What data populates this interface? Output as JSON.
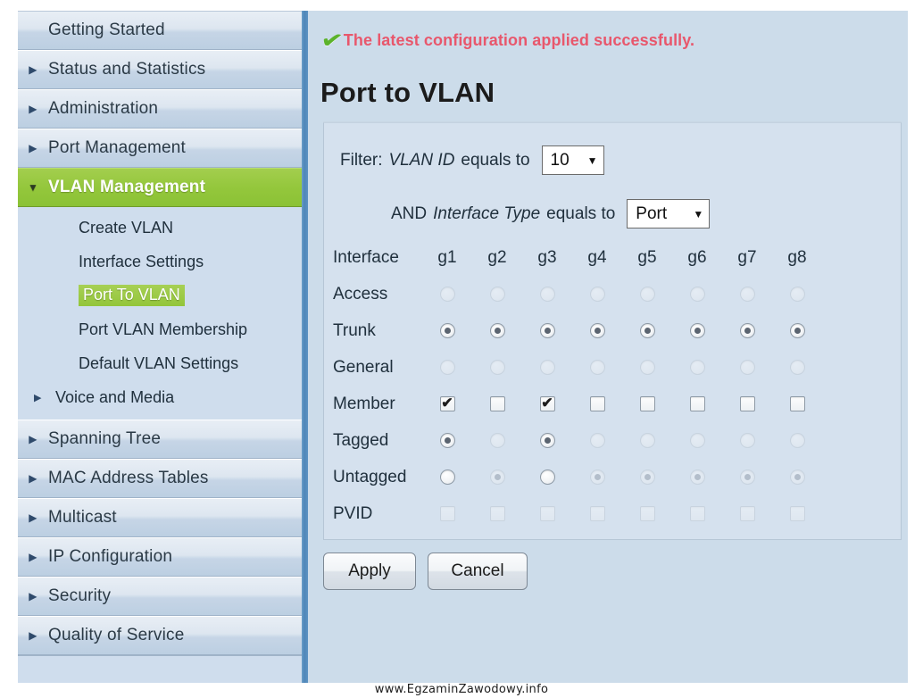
{
  "accent": {
    "green": "#93c53a",
    "status_red": "#e8576c",
    "check_green": "#5cb32b",
    "sidebar_bg": "#cfdded",
    "content_bg": "#ccdcea",
    "panel_bg": "#d5e1ee",
    "divider_blue": "#4f86b8"
  },
  "sidebar": {
    "items": [
      {
        "label": "Getting Started",
        "arrow": "",
        "expanded": false,
        "active": false
      },
      {
        "label": "Status and Statistics",
        "arrow": "▶",
        "expanded": false,
        "active": false
      },
      {
        "label": "Administration",
        "arrow": "▶",
        "expanded": false,
        "active": false
      },
      {
        "label": "Port Management",
        "arrow": "▶",
        "expanded": false,
        "active": false
      },
      {
        "label": "VLAN Management",
        "arrow": "▼",
        "expanded": true,
        "active": true
      }
    ],
    "sub_items": [
      {
        "label": "Create VLAN",
        "arrow": "",
        "selected": false
      },
      {
        "label": "Interface Settings",
        "arrow": "",
        "selected": false
      },
      {
        "label": "Port To VLAN",
        "arrow": "",
        "selected": true
      },
      {
        "label": "Port VLAN Membership",
        "arrow": "",
        "selected": false
      },
      {
        "label": "Default VLAN Settings",
        "arrow": "",
        "selected": false
      },
      {
        "label": "Voice and Media",
        "arrow": "▶",
        "selected": false
      }
    ],
    "items_tail": [
      {
        "label": "Spanning Tree",
        "arrow": "▶"
      },
      {
        "label": "MAC Address Tables",
        "arrow": "▶"
      },
      {
        "label": "Multicast",
        "arrow": "▶"
      },
      {
        "label": "IP Configuration",
        "arrow": "▶"
      },
      {
        "label": "Security",
        "arrow": "▶"
      },
      {
        "label": "Quality of Service",
        "arrow": "▶"
      }
    ]
  },
  "status": {
    "icon": "check-icon",
    "message": "The latest configuration applied successfully."
  },
  "page": {
    "title": "Port to VLAN"
  },
  "filter": {
    "label": "Filter:",
    "field1": "VLAN ID",
    "equals1": "equals to",
    "vlan_id_value": "10",
    "and": "AND",
    "field2": "Interface Type",
    "equals2": "equals to",
    "interface_type_value": "Port",
    "caret": "▼"
  },
  "table": {
    "row_label_header": "Interface",
    "columns": [
      "g1",
      "g2",
      "g3",
      "g4",
      "g5",
      "g6",
      "g7",
      "g8"
    ],
    "rows": [
      {
        "label": "Access",
        "control": "radio",
        "states": [
          "off-dim",
          "off-dim",
          "off-dim",
          "off-dim",
          "off-dim",
          "off-dim",
          "off-dim",
          "off-dim"
        ]
      },
      {
        "label": "Trunk",
        "control": "radio",
        "states": [
          "on",
          "on",
          "on",
          "on",
          "on",
          "on",
          "on",
          "on"
        ]
      },
      {
        "label": "General",
        "control": "radio",
        "states": [
          "off-dim",
          "off-dim",
          "off-dim",
          "off-dim",
          "off-dim",
          "off-dim",
          "off-dim",
          "off-dim"
        ]
      },
      {
        "label": "Member",
        "control": "checkbox",
        "states": [
          "on",
          "off",
          "on",
          "off",
          "off",
          "off",
          "off",
          "off"
        ]
      },
      {
        "label": "Tagged",
        "control": "radio",
        "states": [
          "on",
          "off-dim",
          "on",
          "off-dim",
          "off-dim",
          "off-dim",
          "off-dim",
          "off-dim"
        ]
      },
      {
        "label": "Untagged",
        "control": "radio",
        "states": [
          "off",
          "on-dim",
          "off",
          "on-dim",
          "on-dim",
          "on-dim",
          "on-dim",
          "on-dim"
        ]
      },
      {
        "label": "PVID",
        "control": "checkbox",
        "states": [
          "off-dim",
          "off-dim",
          "off-dim",
          "off-dim",
          "off-dim",
          "off-dim",
          "off-dim",
          "off-dim"
        ]
      }
    ]
  },
  "buttons": {
    "apply": "Apply",
    "cancel": "Cancel"
  },
  "watermark": "www.EgzaminZawodowy.info"
}
